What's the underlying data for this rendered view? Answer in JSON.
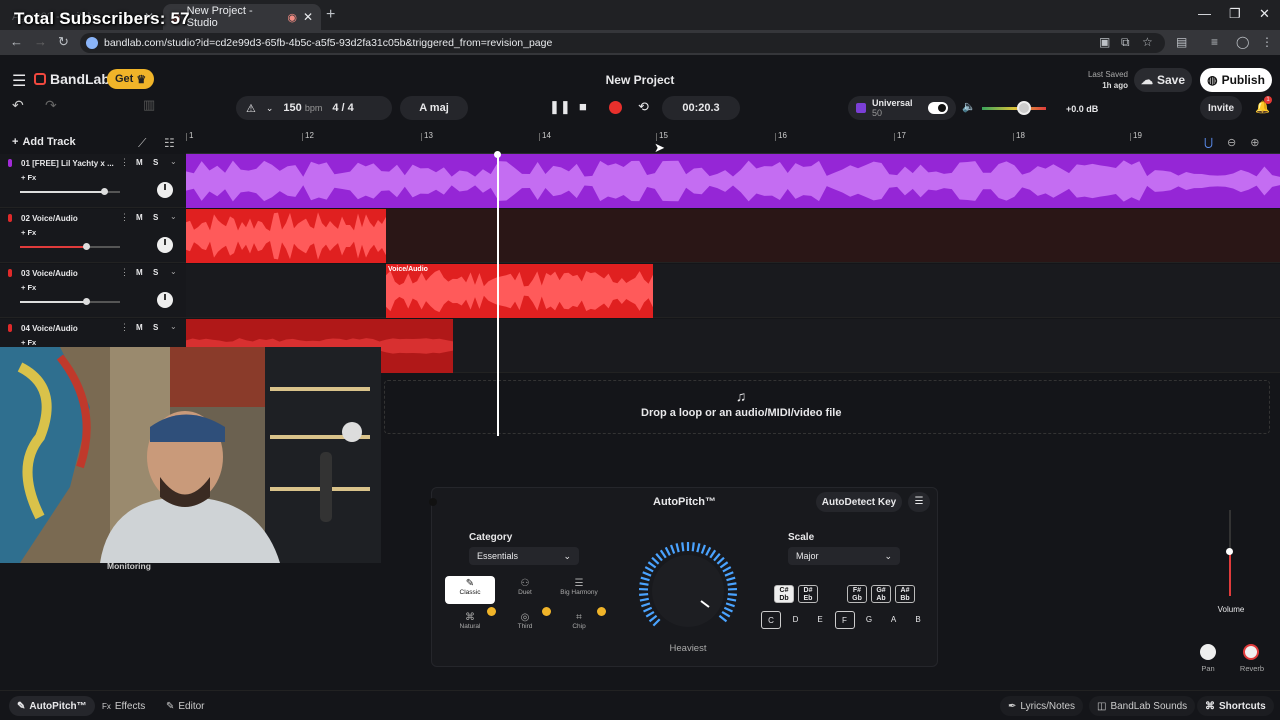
{
  "overlay": {
    "subscribers": "Total Subscribers: 57"
  },
  "browser": {
    "tabs": [
      {
        "label": "Agent00 - Twitch"
      },
      {
        "label": "New Project - Studio"
      }
    ],
    "url": "bandlab.com/studio?id=cd2e99d3-65fb-4b5c-a5f5-93d2fa31c05b&triggered_from=revision_page"
  },
  "header": {
    "logo": "BandLab",
    "get_label": "Get",
    "project_title": "New Project",
    "last_saved_label": "Last Saved",
    "last_saved_value": "1h ago",
    "save_label": "Save",
    "publish_label": "Publish",
    "invite_label": "Invite",
    "notification_count": "1"
  },
  "toolbar": {
    "bpm_value": "150",
    "bpm_unit": "bpm",
    "time_sig_num": "4",
    "time_sig_den": "4",
    "key": "A maj",
    "time": "00:20.3",
    "universal_label": "Universal",
    "universal_sub": "50",
    "db_value": "+0.0 dB",
    "master_volume_level": 0.66
  },
  "timeline": {
    "add_track_label": "Add Track",
    "ruler_ticks": [
      "1",
      "12",
      "13",
      "14",
      "15",
      "16",
      "17",
      "18",
      "19"
    ],
    "drop_text": "Drop a loop or an audio/MIDI/video file"
  },
  "tracks": [
    {
      "name": "01  [FREE] Lil Yachty x ...",
      "fx": "+ Fx",
      "mute": "M",
      "solo": "S",
      "color": "#a32bd9",
      "volume": 0.84
    },
    {
      "name": "02  Voice/Audio",
      "fx": "+ Fx",
      "mute": "M",
      "solo": "S",
      "color": "#e02a2a",
      "volume": 0.66
    },
    {
      "name": "03  Voice/Audio",
      "fx": "+ Fx",
      "mute": "M",
      "solo": "S",
      "color": "#e02a2a",
      "volume": 0.66
    },
    {
      "name": "04  Voice/Audio",
      "fx": "+ Fx",
      "mute": "M",
      "solo": "S",
      "color": "#e02a2a",
      "volume": 0.66
    }
  ],
  "clips": {
    "track3_label": "Voice/Audio"
  },
  "webcam": {
    "monitoring_label": "Monitoring"
  },
  "autopitch": {
    "title": "AutoPitch™",
    "detect_label": "AutoDetect Key",
    "category_label": "Category",
    "category_value": "Essentials",
    "presets": [
      "Classic",
      "Duet",
      "Big Harmony",
      "Natural",
      "Third",
      "Chip"
    ],
    "dial_label": "Heaviest",
    "scale_label": "Scale",
    "scale_value": "Major",
    "sharp_keys": [
      {
        "top": "C#",
        "bottom": "Db"
      },
      {
        "top": "D#",
        "bottom": "Eb"
      },
      {
        "top": "F#",
        "bottom": "Gb"
      },
      {
        "top": "G#",
        "bottom": "Ab"
      },
      {
        "top": "A#",
        "bottom": "Bb"
      }
    ],
    "natural_keys": [
      "C",
      "D",
      "E",
      "F",
      "G",
      "A",
      "B"
    ]
  },
  "mixer": {
    "volume_label": "Volume",
    "pan_label": "Pan",
    "reverb_label": "Reverb"
  },
  "bottom_bar": {
    "autopitch": "AutoPitch™",
    "effects": "Effects",
    "editor": "Editor",
    "lyrics": "Lyrics/Notes",
    "sounds": "BandLab Sounds",
    "shortcuts": "Shortcuts"
  }
}
